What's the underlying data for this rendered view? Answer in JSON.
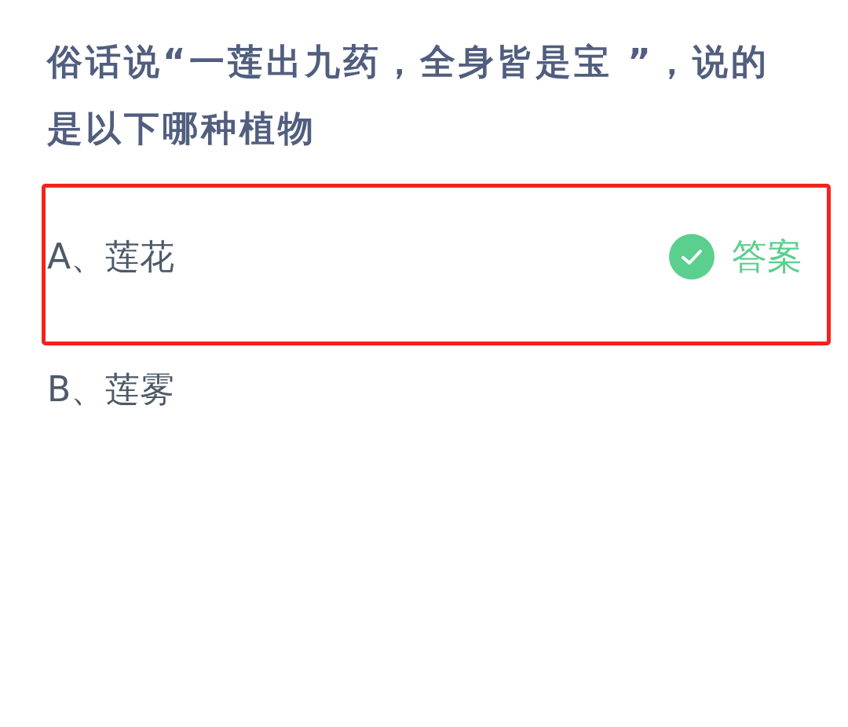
{
  "question": {
    "text": "俗话说“一莲出九药，全身皆是宝 ”，说的是以下哪种植物"
  },
  "options": [
    {
      "text": "A、莲花",
      "highlighted": true,
      "correct": true,
      "answer_label": "答案"
    },
    {
      "text": "B、莲雾",
      "highlighted": false,
      "correct": false
    }
  ]
}
